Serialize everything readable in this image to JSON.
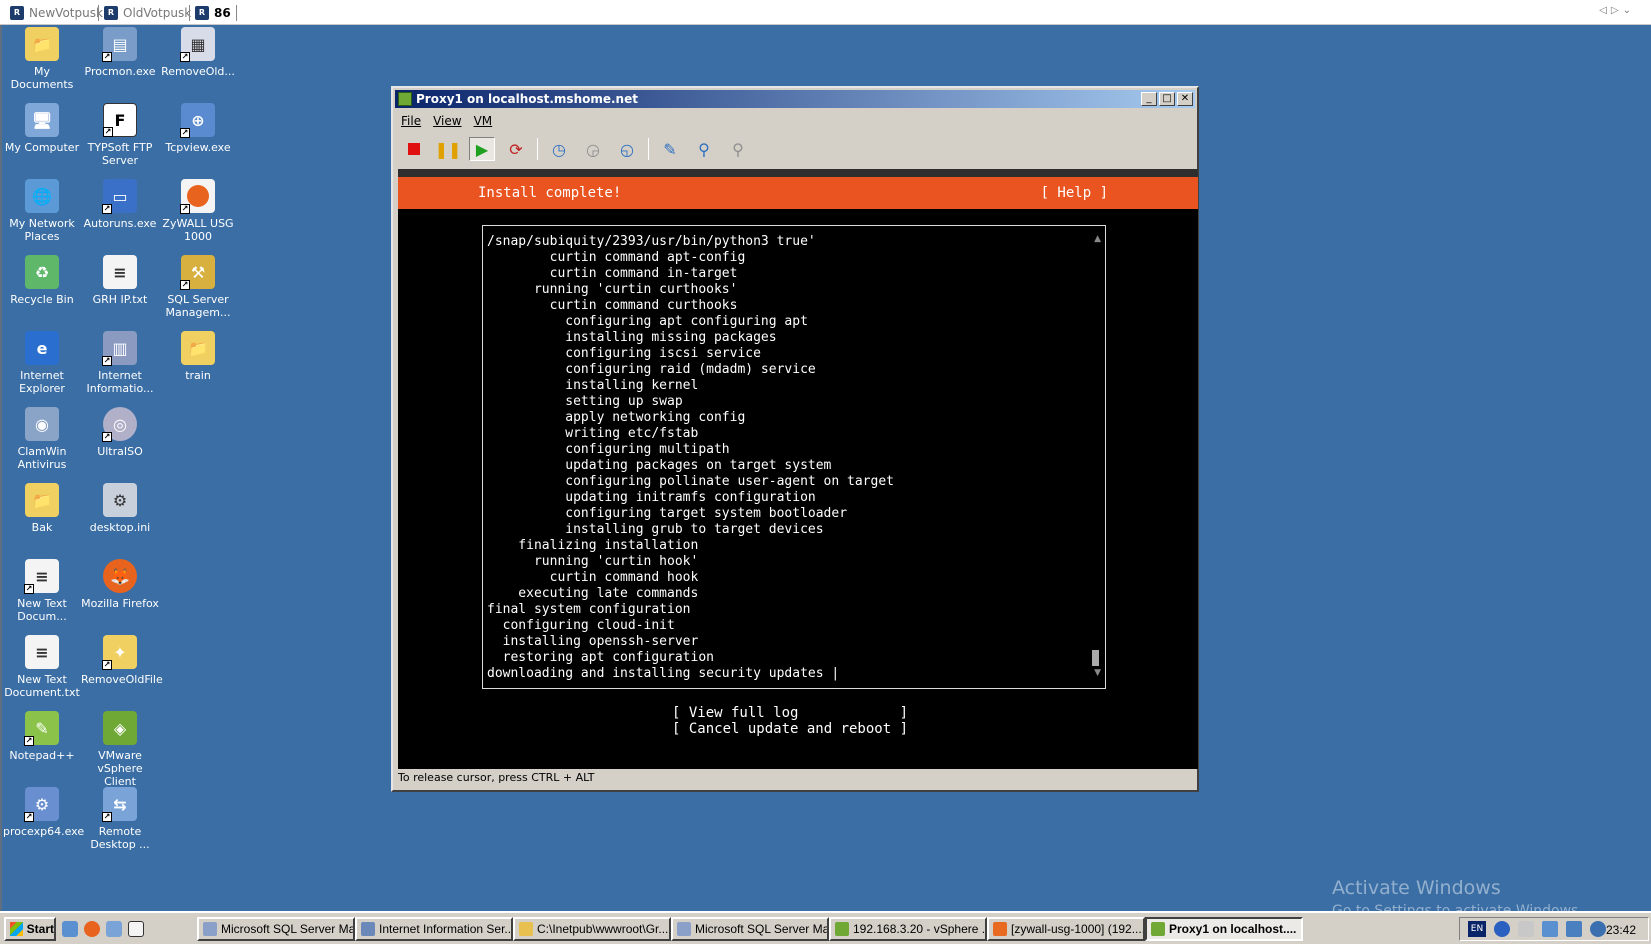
{
  "rdp_tabs": [
    {
      "label": "NewVotpusk"
    },
    {
      "label": "OldVotpusk"
    },
    {
      "label": "86"
    }
  ],
  "desktop_icons": [
    {
      "label": "My Documents",
      "icon": "folder-documents-icon"
    },
    {
      "label": "Procmon.exe",
      "icon": "procmon-icon"
    },
    {
      "label": "RemoveOld...",
      "icon": "remove-old-icon"
    },
    {
      "label": "My Computer",
      "icon": "computer-icon"
    },
    {
      "label": "TYPSoft FTP Server",
      "icon": "ftp-server-icon"
    },
    {
      "label": "Tcpview.exe",
      "icon": "tcpview-icon"
    },
    {
      "label": "My Network Places",
      "icon": "network-places-icon"
    },
    {
      "label": "Autoruns.exe",
      "icon": "autoruns-icon"
    },
    {
      "label": "ZyWALL USG 1000",
      "icon": "firefox-shortcut-icon"
    },
    {
      "label": "Recycle Bin",
      "icon": "recycle-bin-icon"
    },
    {
      "label": "GRH IP.txt",
      "icon": "text-file-icon"
    },
    {
      "label": "SQL Server Managem...",
      "icon": "sql-server-icon"
    },
    {
      "label": "Internet Explorer",
      "icon": "internet-explorer-icon"
    },
    {
      "label": "Internet Informatio...",
      "icon": "iis-icon"
    },
    {
      "label": "train",
      "icon": "folder-icon"
    },
    {
      "label": "ClamWin Antivirus",
      "icon": "clamwin-icon"
    },
    {
      "label": "UltraISO",
      "icon": "ultraiso-icon"
    },
    {
      "label": "Bak",
      "icon": "folder-icon"
    },
    {
      "label": "desktop.ini",
      "icon": "ini-file-icon"
    },
    {
      "label": "New Text Docum...",
      "icon": "text-file-icon"
    },
    {
      "label": "Mozilla Firefox",
      "icon": "firefox-icon"
    },
    {
      "label": "New Text Document.txt",
      "icon": "text-file-icon"
    },
    {
      "label": "RemoveOldFile",
      "icon": "remove-old-file-icon"
    },
    {
      "label": "Notepad++",
      "icon": "notepad-plus-icon"
    },
    {
      "label": "VMware vSphere Client",
      "icon": "vsphere-icon"
    },
    {
      "label": "procexp64.exe",
      "icon": "procexp-icon"
    },
    {
      "label": "Remote Desktop ...",
      "icon": "remote-desktop-icon"
    }
  ],
  "console": {
    "title": "Proxy1 on localhost.mshome.net",
    "menu": [
      "File",
      "View",
      "VM"
    ],
    "toolbar": [
      "stop-icon",
      "pause-icon",
      "play-icon",
      "reset-icon",
      "snapshot-icon",
      "revert-snapshot-icon",
      "manage-snapshots-icon",
      "edit-settings-icon",
      "connect-cd-icon",
      "connect-floppy-icon"
    ],
    "status": "To release cursor, press CTRL + ALT"
  },
  "installer": {
    "banner_title": "Install complete!",
    "help": "[ Help ]",
    "log_lines": [
      "/snap/subiquity/2393/usr/bin/python3 true'",
      "        curtin command apt-config",
      "        curtin command in-target",
      "      running 'curtin curthooks'",
      "        curtin command curthooks",
      "          configuring apt configuring apt",
      "          installing missing packages",
      "          configuring iscsi service",
      "          configuring raid (mdadm) service",
      "          installing kernel",
      "          setting up swap",
      "          apply networking config",
      "          writing etc/fstab",
      "          configuring multipath",
      "          updating packages on target system",
      "          configuring pollinate user-agent on target",
      "          updating initramfs configuration",
      "          configuring target system bootloader",
      "          installing grub to target devices",
      "    finalizing installation",
      "      running 'curtin hook'",
      "        curtin command hook",
      "    executing late commands",
      "final system configuration",
      "  configuring cloud-init",
      "  installing openssh-server",
      "  restoring apt configuration",
      "downloading and installing security updates |"
    ],
    "btn_view_log": "[ View full log            ]",
    "btn_cancel": "[ Cancel update and reboot ]"
  },
  "activation": {
    "line1": "Activate Windows",
    "line2": "Go to Settings to activate Windows."
  },
  "taskbar": {
    "start": "Start",
    "tasks": [
      {
        "label": "Microsoft SQL Server Ma...",
        "color": "#8aa0c8"
      },
      {
        "label": "Internet Information Ser...",
        "color": "#6a88b8"
      },
      {
        "label": "C:\\Inetpub\\wwwroot\\Gr...",
        "color": "#e8c050"
      },
      {
        "label": "Microsoft SQL Server Ma...",
        "color": "#8aa0c8"
      },
      {
        "label": "192.168.3.20 - vSphere ...",
        "color": "#6fa835"
      },
      {
        "label": "[zywall-usg-1000] (192....",
        "color": "#e86a20"
      },
      {
        "label": "Proxy1 on localhost....",
        "color": "#6fa835"
      }
    ],
    "lang": "EN",
    "clock": "23:42"
  }
}
